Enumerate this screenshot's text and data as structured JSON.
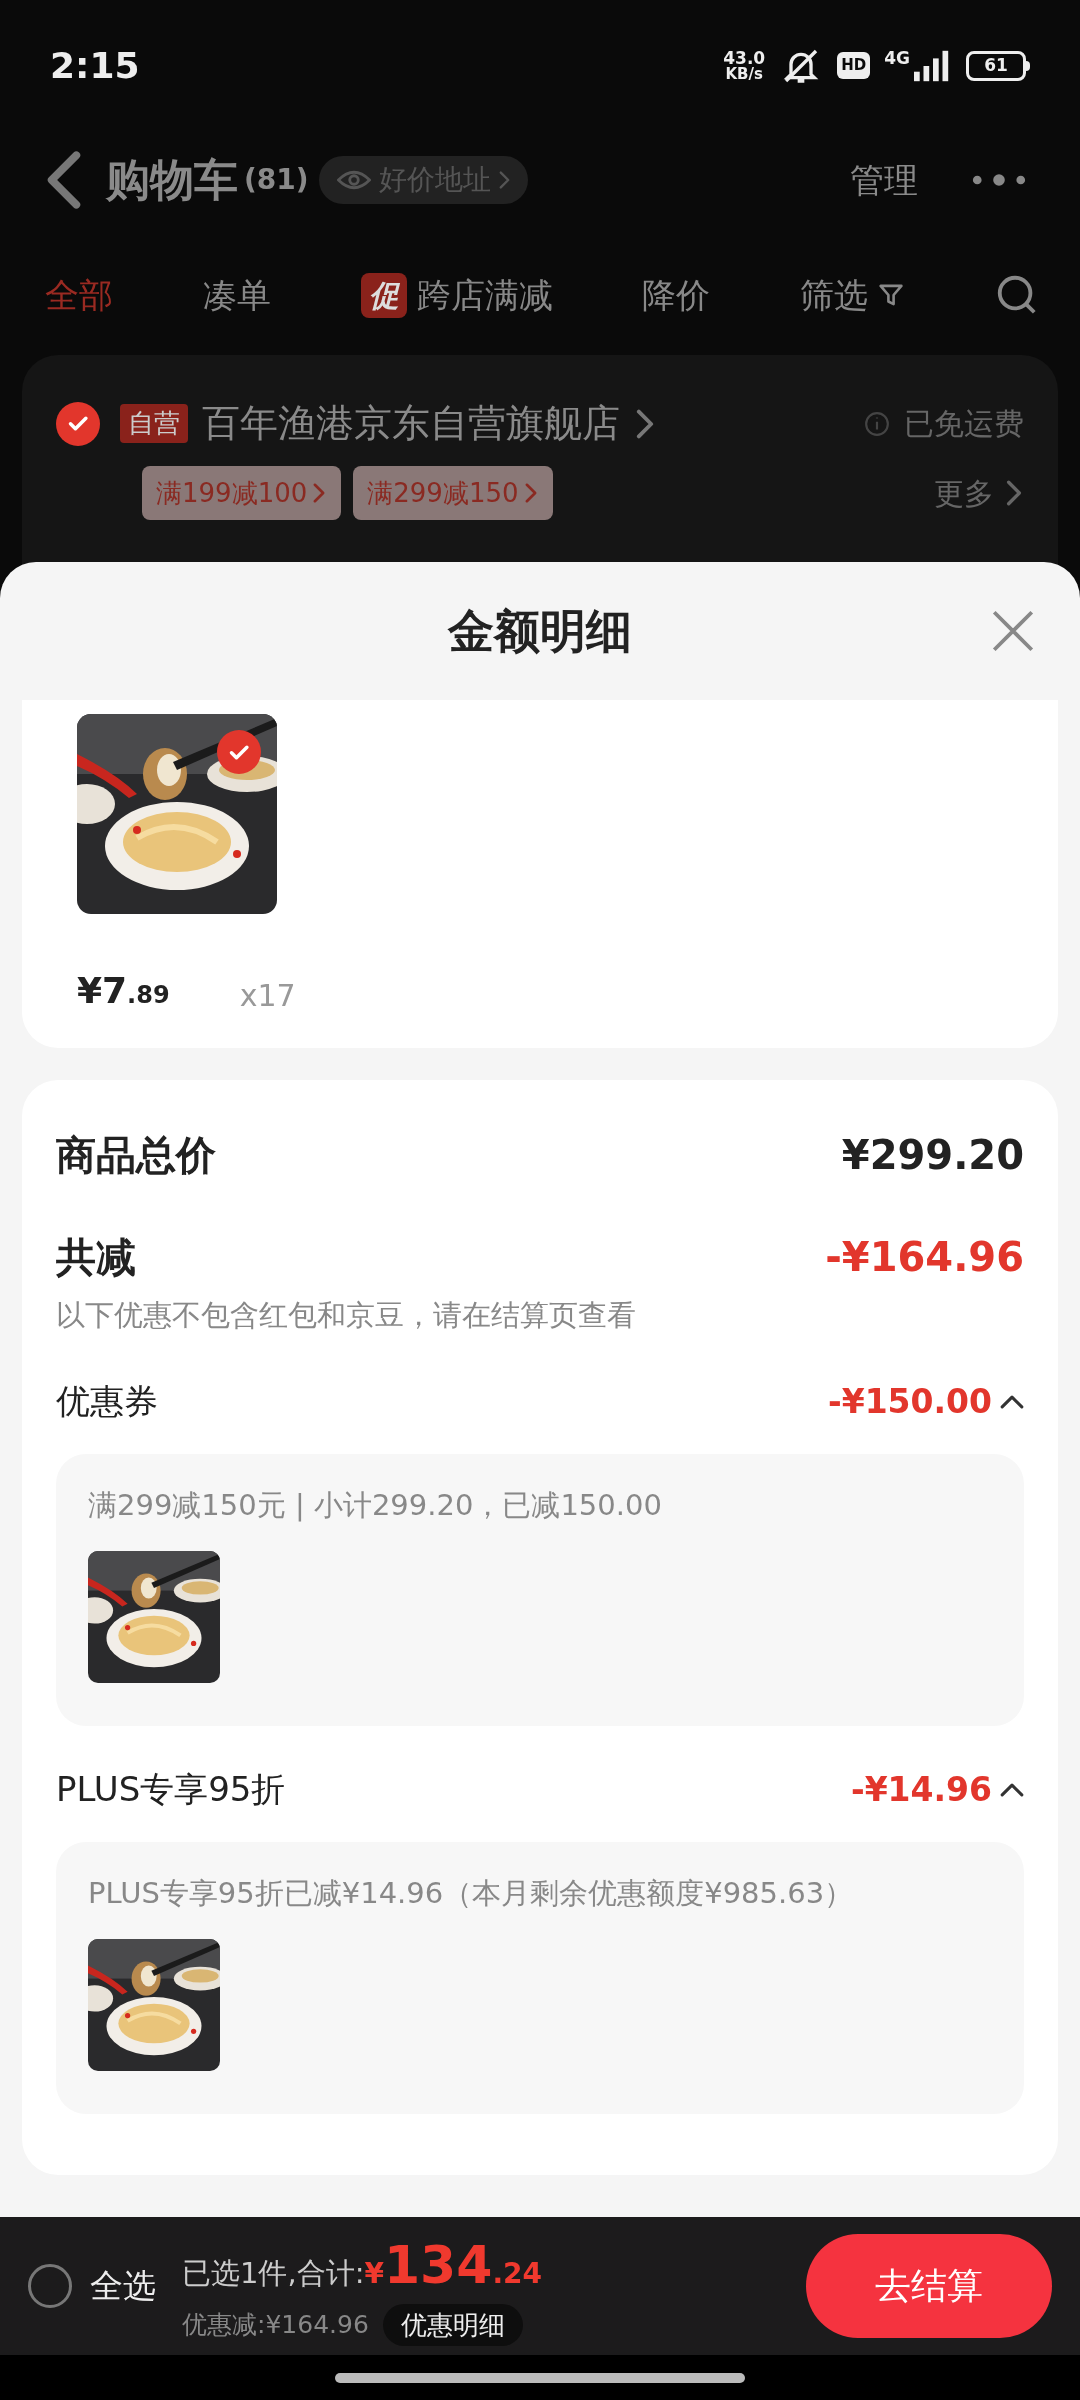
{
  "status_bar": {
    "time": "2:15",
    "speed_value": "43.0",
    "speed_unit": "KB/s",
    "hd": "HD",
    "network": "4G",
    "battery": "61"
  },
  "header": {
    "title": "购物车",
    "count": "(81)",
    "address_chip": "好价地址",
    "manage": "管理"
  },
  "tabs": [
    {
      "kind": "text",
      "label": "全部",
      "selected": true
    },
    {
      "kind": "text",
      "label": "凑单",
      "selected": false
    },
    {
      "kind": "promo",
      "badge": "促",
      "label": "跨店满减",
      "selected": false
    },
    {
      "kind": "text",
      "label": "降价",
      "selected": false
    },
    {
      "kind": "filter",
      "label": "筛选",
      "selected": false
    }
  ],
  "store": {
    "checked": true,
    "tag": "自营",
    "name": "百年渔港京东自营旗舰店",
    "shipping": "已免运费",
    "coupons": [
      "满199减100",
      "满299减150"
    ],
    "more": "更多"
  },
  "sheet": {
    "title": "金额明细",
    "product": {
      "selected": true,
      "price_main": "¥7",
      "price_decimal": ".89",
      "quantity": "x17"
    },
    "summary": {
      "total_label": "商品总价",
      "total": "¥299.20",
      "discount_label": "共减",
      "discount": "-¥164.96",
      "note": "以下优惠不包含红包和京豆，请在结算页查看",
      "groups": [
        {
          "name": "优惠券",
          "amount": "-¥150.00",
          "expanded": true,
          "detail": "满299减150元 | 小计299.20，已减150.00"
        },
        {
          "name": "PLUS专享95折",
          "amount": "-¥14.96",
          "expanded": true,
          "detail": "PLUS专享95折已减¥14.96（本月剩余优惠额度¥985.63）"
        }
      ]
    }
  },
  "bottom_bar": {
    "select_all": {
      "label": "全选",
      "checked": false
    },
    "selected_text": "已选1件,合计:",
    "currency": "¥",
    "total_main": "134",
    "total_decimal": ".24",
    "saved": "优惠减:¥164.96",
    "detail_button": "优惠明细",
    "checkout": "去结算"
  }
}
